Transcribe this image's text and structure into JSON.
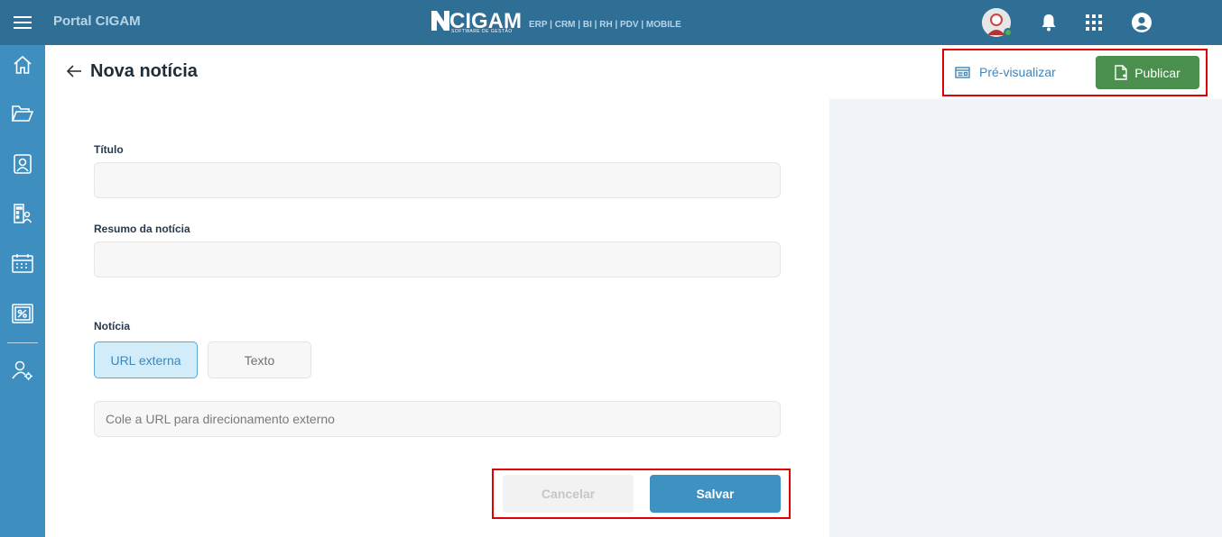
{
  "header": {
    "portal_title": "Portal CIGAM",
    "logo_text": "CIGAM",
    "logo_subtitle": "SOFTWARE DE GESTÃO",
    "logo_products": "ERP | CRM | BI | RH | PDV | MOBILE",
    "icons": [
      "menu-icon",
      "avatar",
      "bell-icon",
      "apps-grid-icon",
      "account-circle-icon"
    ]
  },
  "sidebar": {
    "items": [
      {
        "icon": "home-icon"
      },
      {
        "icon": "folder-open-icon"
      },
      {
        "icon": "contact-card-icon"
      },
      {
        "icon": "building-user-icon"
      },
      {
        "icon": "calendar-icon"
      },
      {
        "icon": "ticket-icon"
      },
      {
        "icon": "user-settings-icon"
      }
    ]
  },
  "page": {
    "title": "Nova notícia",
    "preview_label": "Pré-visualizar",
    "publish_label": "Publicar"
  },
  "form": {
    "title_label": "Título",
    "title_value": "",
    "summary_label": "Resumo da notícia",
    "summary_value": "",
    "news_label": "Notícia",
    "toggle_url_label": "URL externa",
    "toggle_text_label": "Texto",
    "toggle_selected": "URL externa",
    "url_placeholder": "Cole a URL para direcionamento externo",
    "cancel_label": "Cancelar",
    "save_label": "Salvar"
  },
  "colors": {
    "topbar": "#2f6f96",
    "sidebar": "#3e8fc0",
    "publish": "#4a8f4e",
    "save": "#3d92c2",
    "highlight": "#e00000"
  }
}
